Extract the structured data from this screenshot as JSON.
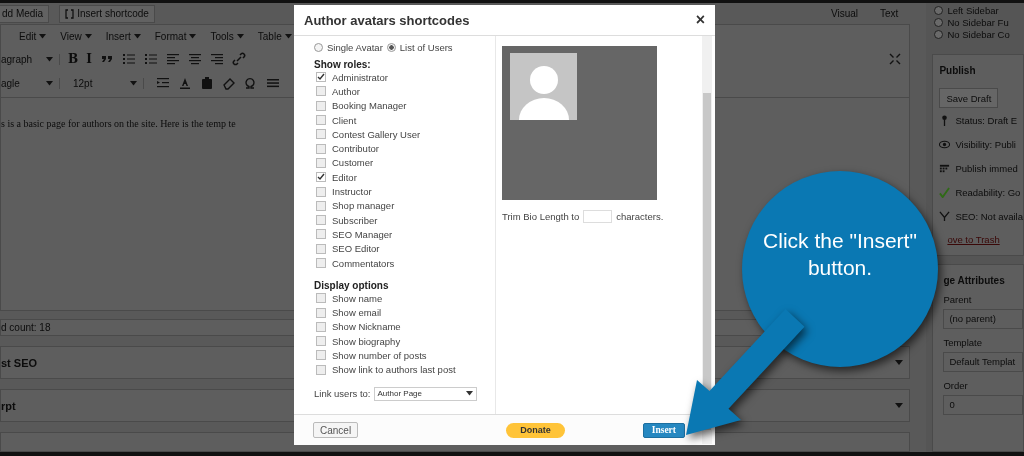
{
  "editor": {
    "media_buttons": [
      {
        "kind": "media",
        "label": "dd Media"
      },
      {
        "kind": "shortcode",
        "label": "Insert shortcode"
      }
    ],
    "mode_tabs": [
      "Visual",
      "Text"
    ],
    "menu": [
      "Edit",
      "View",
      "Insert",
      "Format",
      "Tools",
      "Table"
    ],
    "format_select": "agraph",
    "font_select": "agle",
    "size_select": "12pt",
    "toolbar_1": [
      {
        "kind": "glyph",
        "text": "B"
      },
      {
        "kind": "glyph",
        "text": "I"
      },
      {
        "kind": "quote"
      },
      {
        "kind": "bullets"
      },
      {
        "kind": "numbers"
      },
      {
        "kind": "align-left"
      },
      {
        "kind": "align-center"
      },
      {
        "kind": "align-right"
      },
      {
        "kind": "link"
      }
    ],
    "toolbar_2": [
      {
        "kind": "indent"
      },
      {
        "kind": "text-color"
      },
      {
        "kind": "paste"
      },
      {
        "kind": "eraser"
      },
      {
        "kind": "omega"
      },
      {
        "kind": "lines"
      }
    ],
    "content": "s is a basic page for authors on the site. Here is the temp te",
    "word_count": "d count: 18",
    "panels": [
      "st SEO",
      "rpt"
    ]
  },
  "sidebar": {
    "template_options": [
      {
        "label": "Left Sidebar",
        "selected": false
      },
      {
        "label": "No Sidebar Fu",
        "selected": false
      },
      {
        "label": "No Sidebar Co",
        "selected": false
      }
    ],
    "publish": {
      "title": "Publish",
      "save_button": "Save Draft",
      "items": [
        {
          "kind": "status",
          "text": "Status: Draft E"
        },
        {
          "kind": "visibility",
          "text": "Visibility: Publi"
        },
        {
          "kind": "schedule",
          "text": "Publish immed"
        },
        {
          "kind": "readability",
          "text": "Readability: Go"
        },
        {
          "kind": "seo",
          "text": "SEO: Not availa"
        }
      ],
      "trash_link": "ove to Trash"
    },
    "attributes": {
      "title": "ge Attributes",
      "fields": [
        {
          "label": "Parent",
          "value": "(no parent)"
        },
        {
          "label": "Template",
          "value": "Default Templat"
        },
        {
          "label": "Order",
          "value": "0"
        }
      ]
    }
  },
  "modal": {
    "title": "Author avatars shortcodes",
    "close": "×",
    "display_type": [
      {
        "label": "Single Avatar",
        "selected": false
      },
      {
        "label": "List of Users",
        "selected": true
      }
    ],
    "roles_heading": "Show roles:",
    "roles": [
      {
        "label": "Administrator",
        "checked": true
      },
      {
        "label": "Author",
        "checked": false
      },
      {
        "label": "Booking Manager",
        "checked": false
      },
      {
        "label": "Client",
        "checked": false
      },
      {
        "label": "Contest Gallery User",
        "checked": false
      },
      {
        "label": "Contributor",
        "checked": false
      },
      {
        "label": "Customer",
        "checked": false
      },
      {
        "label": "Editor",
        "checked": true
      },
      {
        "label": "Instructor",
        "checked": false
      },
      {
        "label": "Shop manager",
        "checked": false
      },
      {
        "label": "Subscriber",
        "checked": false
      },
      {
        "label": "SEO Manager",
        "checked": false
      },
      {
        "label": "SEO Editor",
        "checked": false
      },
      {
        "label": "Commentators",
        "checked": false
      }
    ],
    "options_heading": "Display options",
    "options": [
      {
        "label": "Show name",
        "checked": false
      },
      {
        "label": "Show email",
        "checked": false
      },
      {
        "label": "Show Nickname",
        "checked": false
      },
      {
        "label": "Show biography",
        "checked": false
      },
      {
        "label": "Show number of posts",
        "checked": false
      },
      {
        "label": "Show link to authors last post",
        "checked": false
      }
    ],
    "link_label": "Link users to:",
    "link_select": "Author Page",
    "trim_label": "Trim Bio Length to",
    "trim_suffix": "characters.",
    "cancel": "Cancel",
    "donate": "Donate",
    "insert": "Insert"
  },
  "callout": {
    "text": "Click the \"Insert\" button."
  }
}
